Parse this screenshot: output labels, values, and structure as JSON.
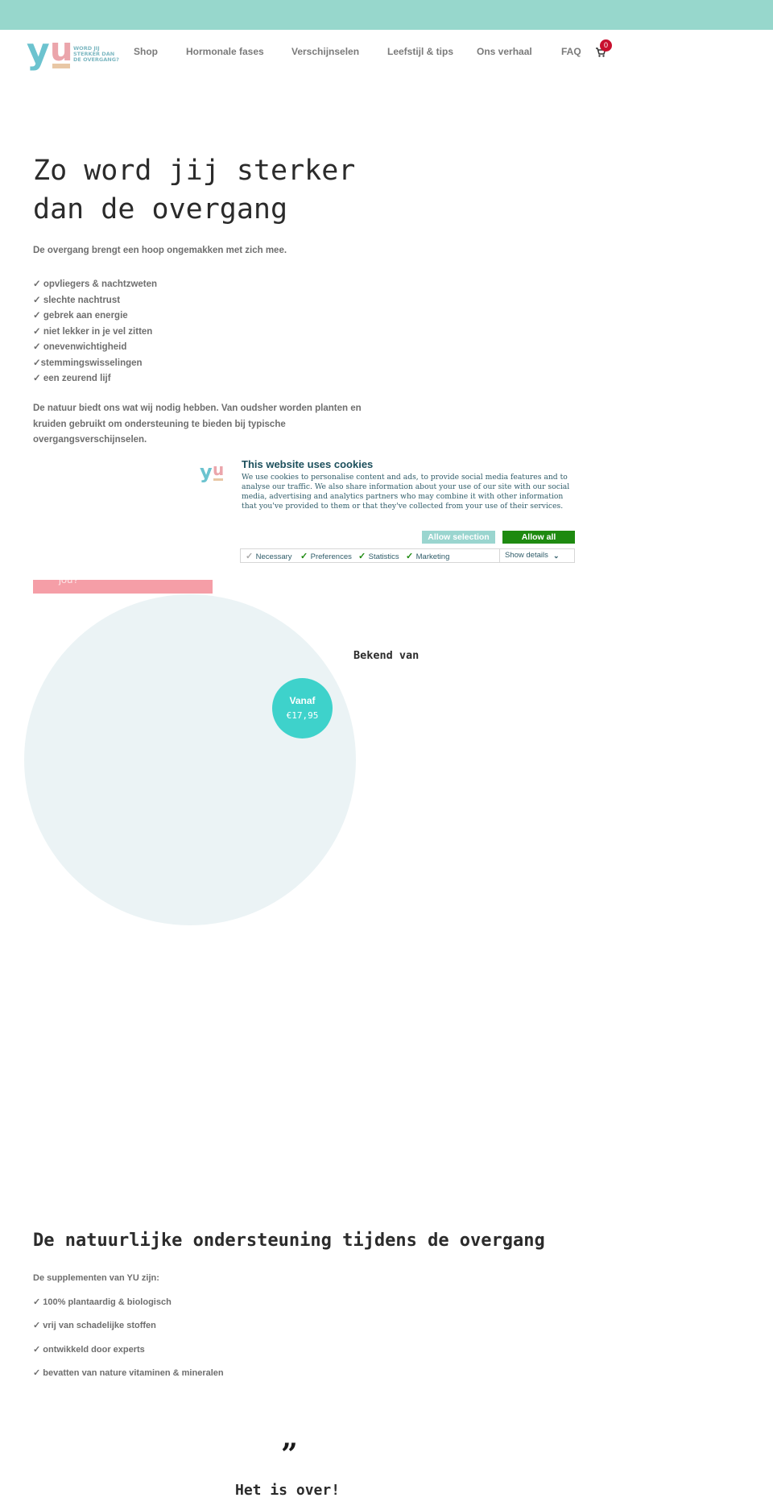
{
  "brand": {
    "logo_letters": {
      "y": "y",
      "u": "u"
    },
    "tagline": "WORD JIJ STERKER DAN DE OVERGANG?",
    "colors": {
      "topbar": "#97d7cc",
      "logo_y": "#6cc3cf",
      "logo_u": "#eba5ab",
      "logo_bar": "#e8c7a5",
      "accent_teal": "#3ed2cb",
      "pink": "#f59ea7",
      "cart_badge": "#c8102e"
    }
  },
  "nav": {
    "items": [
      {
        "label": "Shop"
      },
      {
        "label": "Hormonale fases"
      },
      {
        "label": "Verschijnselen"
      },
      {
        "label": "Leefstijl & tips"
      },
      {
        "label": "Ons verhaal"
      },
      {
        "label": "FAQ"
      }
    ],
    "cart": {
      "icon": "cart-icon",
      "count": "0"
    }
  },
  "hero": {
    "title": "Zo word jij sterker dan de overgang",
    "intro": "De overgang brengt een hoop ongemakken met zich mee.",
    "symptoms": [
      "✓ opvliegers & nachtzweten",
      "✓ slechte nachtrust",
      "✓ gebrek aan energie",
      "✓ niet lekker in je vel zitten",
      "✓ onevenwichtigheid",
      "✓stemmingswisselingen",
      "✓ een zeurend lijf"
    ],
    "nature_text": "De natuur biedt ons wat wij nodig hebben. Van oudsher worden planten en kruiden gebruikt om ondersteuning te bieden bij typische overgangsverschijnselen.",
    "cta_partial": "jou?"
  },
  "product": {
    "price_label": "Vanaf",
    "price_value": "€17,95"
  },
  "press": {
    "title": "Bekend van"
  },
  "cookie_banner": {
    "logo_letters": {
      "y": "y",
      "u": "u"
    },
    "title": "This website uses cookies",
    "text": "We use cookies to personalise content and ads, to provide social media features and to analyse our traffic. We also share information about your use of our site with our social media, advertising and analytics partners who may combine it with other information that you've provided to them or that they've collected from your use of their services.",
    "allow_selection_label": "Allow selection",
    "allow_all_label": "Allow all",
    "options": [
      {
        "label": "Necessary",
        "checked": true,
        "disabled": true
      },
      {
        "label": "Preferences",
        "checked": true,
        "disabled": false
      },
      {
        "label": "Statistics",
        "checked": true,
        "disabled": false
      },
      {
        "label": "Marketing",
        "checked": true,
        "disabled": false
      }
    ],
    "show_details_label": "Show details"
  },
  "supplements": {
    "title": "De natuurlijke ondersteuning tijdens de overgang",
    "intro": "De supplementen van YU zijn:",
    "items": [
      "✓ 100% plantaardig & biologisch",
      "✓ vrij van schadelijke stoffen",
      "✓ ontwikkeld door experts",
      "✓ bevatten van nature vitaminen & mineralen"
    ]
  },
  "testimonial": {
    "quote_mark": "”",
    "title": "Het is over!"
  }
}
